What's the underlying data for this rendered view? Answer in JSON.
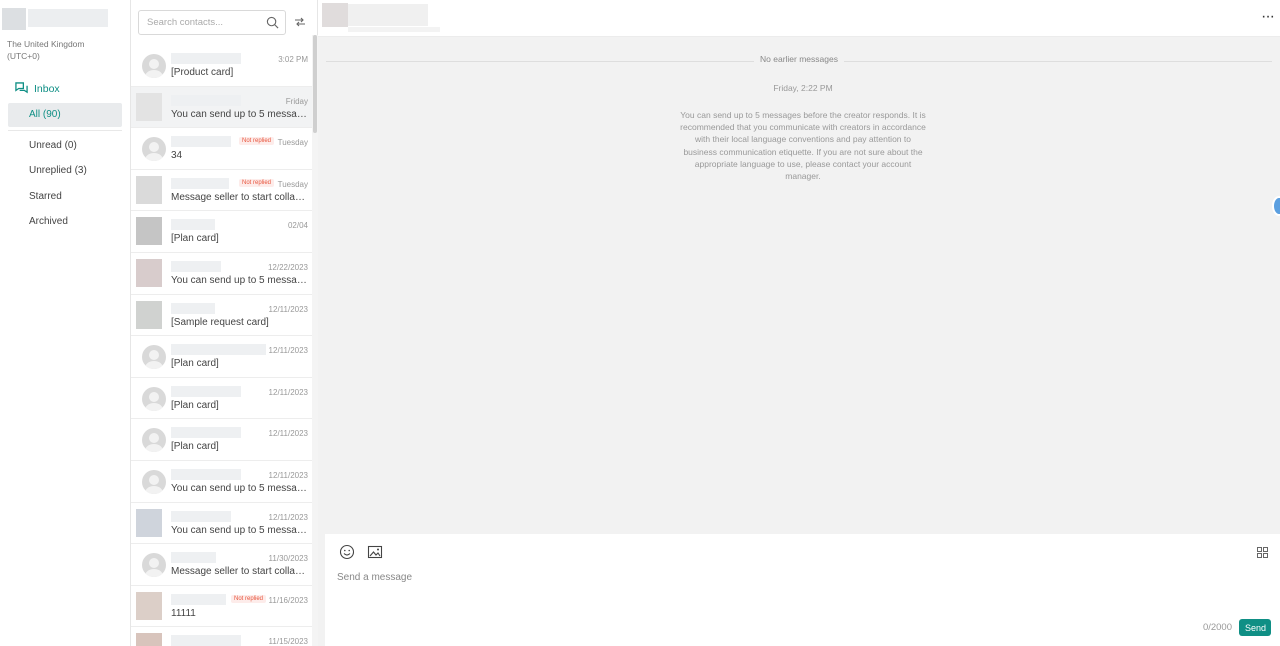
{
  "account": {
    "timezone": "The United Kingdom (UTC+0)"
  },
  "sidebar": {
    "inbox_label": "Inbox",
    "items": [
      {
        "label": "All (90)"
      },
      {
        "label": "Unread (0)"
      },
      {
        "label": "Unreplied (3)"
      },
      {
        "label": "Starred"
      },
      {
        "label": "Archived"
      }
    ]
  },
  "contacts": {
    "search_placeholder": "Search contacts...",
    "rows": [
      {
        "time": "3:02 PM",
        "preview": "[Product card]",
        "badge": ""
      },
      {
        "time": "Friday",
        "preview": "You can send up to 5 messag...",
        "badge": ""
      },
      {
        "time": "Tuesday",
        "preview": "34",
        "badge": "Not replied"
      },
      {
        "time": "Tuesday",
        "preview": "Message seller to start collab...",
        "badge": "Not replied"
      },
      {
        "time": "02/04",
        "preview": "[Plan card]",
        "badge": ""
      },
      {
        "time": "12/22/2023",
        "preview": "You can send up to 5 messag...",
        "badge": ""
      },
      {
        "time": "12/11/2023",
        "preview": "[Sample request card]",
        "badge": ""
      },
      {
        "time": "12/11/2023",
        "preview": "[Plan card]",
        "badge": ""
      },
      {
        "time": "12/11/2023",
        "preview": "[Plan card]",
        "badge": ""
      },
      {
        "time": "12/11/2023",
        "preview": "[Plan card]",
        "badge": ""
      },
      {
        "time": "12/11/2023",
        "preview": "You can send up to 5 messag...",
        "badge": ""
      },
      {
        "time": "12/11/2023",
        "preview": "You can send up to 5 messag...",
        "badge": ""
      },
      {
        "time": "11/30/2023",
        "preview": "Message seller to start collab...",
        "badge": ""
      },
      {
        "time": "11/16/2023",
        "preview": "11111",
        "badge": "Not replied"
      },
      {
        "time": "11/15/2023",
        "preview": "",
        "badge": ""
      }
    ]
  },
  "chat": {
    "no_earlier": "No earlier messages",
    "date": "Friday, 2:22 PM",
    "notice": "You can send up to 5 messages before the creator responds. It is recommended that you communicate with creators in accordance with their local language conventions and pay attention to business communication etiquette. If you are not sure about the appropriate language to use, please contact your account manager.",
    "more_label": "···"
  },
  "composer": {
    "placeholder": "Send a message",
    "counter": "0/2000",
    "send_label": "Send"
  },
  "colors": {
    "accent": "#0f8f85",
    "badge": "#e8553d"
  }
}
